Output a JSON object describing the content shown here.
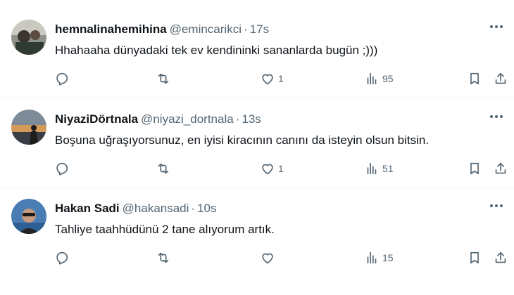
{
  "tweets": [
    {
      "name": "hemnalinahemihina",
      "handle": "@emincarikci",
      "separator": "·",
      "time": "17s",
      "text": "Hhahaaha dünyadaki tek ev kendininki sananlarda bugün ;)))",
      "likes": "1",
      "views": "95",
      "avatar_colors": [
        "#4d5a52",
        "#a0a49a"
      ]
    },
    {
      "name": "NiyaziDörtnala",
      "handle": "@niyazi_dortnala",
      "separator": "·",
      "time": "13s",
      "text": "Boşuna uğraşıyorsunuz, en iyisi kiracının canını da isteyin olsun bitsin.",
      "likes": "1",
      "views": "51",
      "avatar_colors": [
        "#6a7a8c",
        "#d59a5b"
      ]
    },
    {
      "name": "Hakan Sadi",
      "handle": "@hakansadi",
      "separator": "·",
      "time": "10s",
      "text": "Tahliye taahhüdünü 2 tane alıyorum artık.",
      "likes": "",
      "views": "15",
      "avatar_colors": [
        "#4b7db5",
        "#2c2c2c"
      ]
    }
  ],
  "icons": {
    "reply": "reply-icon",
    "retweet": "retweet-icon",
    "like": "heart-icon",
    "views": "views-icon",
    "bookmark": "bookmark-icon",
    "share": "share-icon",
    "more": "more-icon"
  },
  "colors": {
    "text": "#0f1419",
    "secondary": "#536471",
    "divider": "#eff3f4"
  }
}
